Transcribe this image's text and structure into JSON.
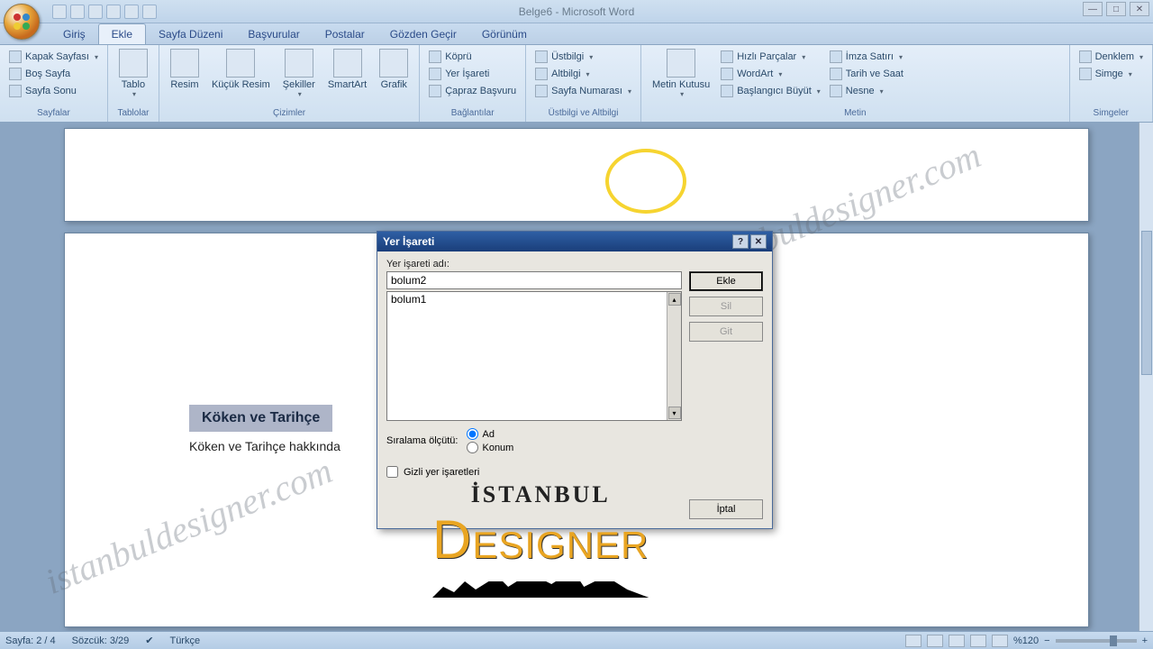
{
  "title": "Belge6 - Microsoft Word",
  "tabs": [
    "Giriş",
    "Ekle",
    "Sayfa Düzeni",
    "Başvurular",
    "Postalar",
    "Gözden Geçir",
    "Görünüm"
  ],
  "active_tab": 1,
  "ribbon": {
    "sayfalar": {
      "label": "Sayfalar",
      "kapak": "Kapak Sayfası",
      "bos": "Boş Sayfa",
      "sonu": "Sayfa Sonu"
    },
    "tablolar": {
      "label": "Tablolar",
      "tablo": "Tablo"
    },
    "cizimler": {
      "label": "Çizimler",
      "resim": "Resim",
      "kucuk": "Küçük Resim",
      "sekiller": "Şekiller",
      "smartart": "SmartArt",
      "grafik": "Grafik"
    },
    "baglantilar": {
      "label": "Bağlantılar",
      "kopru": "Köprü",
      "yer": "Yer İşareti",
      "capraz": "Çapraz Başvuru"
    },
    "ustalt": {
      "label": "Üstbilgi ve Altbilgi",
      "ust": "Üstbilgi",
      "alt": "Altbilgi",
      "sayfano": "Sayfa Numarası"
    },
    "metin": {
      "label": "Metin",
      "kutusu": "Metin Kutusu",
      "hizli": "Hızlı Parçalar",
      "wordart": "WordArt",
      "baslangic": "Başlangıcı Büyüt",
      "imza": "İmza Satırı",
      "tarih": "Tarih ve Saat",
      "nesne": "Nesne"
    },
    "simgeler": {
      "label": "Simgeler",
      "denklem": "Denklem",
      "simge": "Simge"
    }
  },
  "document": {
    "heading": "Köken ve Tarihçe",
    "para": "Köken ve Tarihçe hakkında "
  },
  "dialog": {
    "title": "Yer İşareti",
    "name_label": "Yer işareti adı:",
    "name_value": "bolum2",
    "list": [
      "bolum1"
    ],
    "sort_label": "Sıralama ölçütü:",
    "sort_ad": "Ad",
    "sort_konum": "Konum",
    "hidden": "Gizli yer işaretleri",
    "ekle": "Ekle",
    "sil": "Sil",
    "git": "Git",
    "iptal": "İptal"
  },
  "status": {
    "page": "Sayfa: 2 / 4",
    "words": "Sözcük: 3/29",
    "lang": "Türkçe",
    "zoom": "%120"
  },
  "watermark": "istanbuldesigner.com",
  "logo": {
    "l1": "İSTANBUL",
    "l2": "ESIGNER"
  }
}
